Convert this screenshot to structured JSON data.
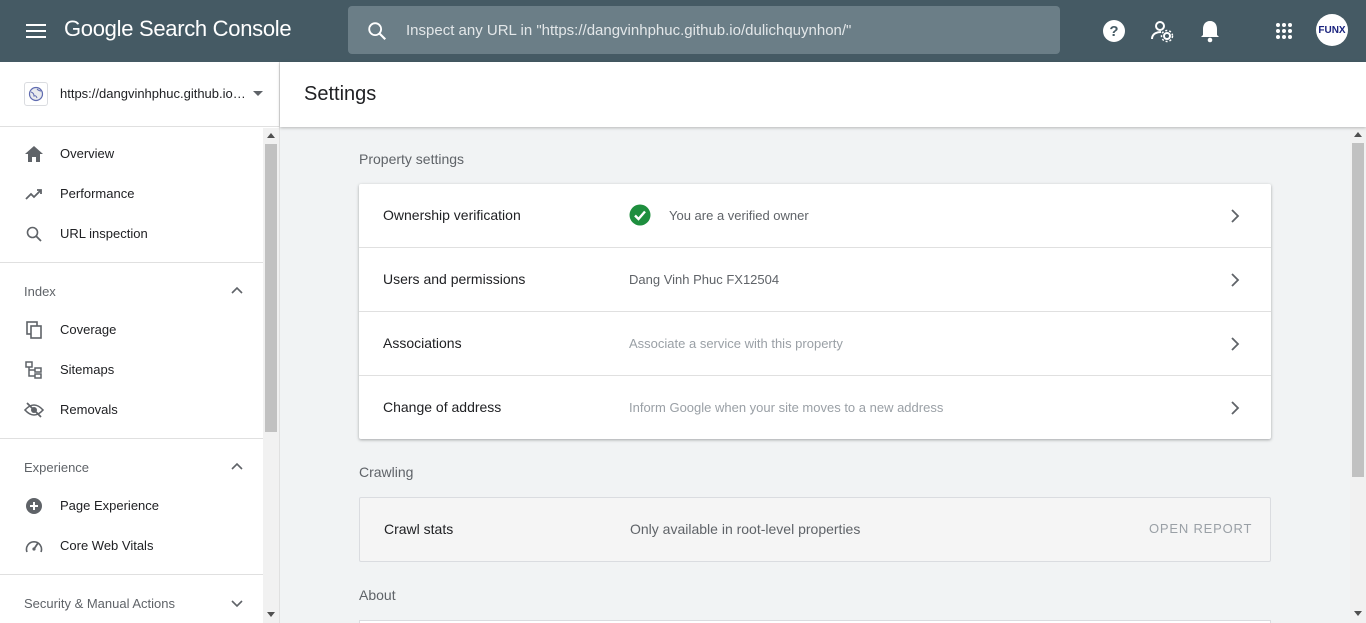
{
  "topbar": {
    "app_title": "Google Search Console",
    "search_placeholder": "Inspect any URL in \"https://dangvinhphuc.github.io/dulichquynhon/\"",
    "avatar_text": "FUNX",
    "icons": [
      "menu-icon",
      "search-icon",
      "help-icon",
      "manage-users-icon",
      "notifications-icon",
      "apps-grid-icon"
    ],
    "bar_color": "#455a64"
  },
  "property": {
    "url": "https://dangvinhphuc.github.io/dulichquynhon/"
  },
  "sidebar": {
    "top_items": [
      {
        "label": "Overview",
        "icon": "home-icon"
      },
      {
        "label": "Performance",
        "icon": "trending-up-icon"
      },
      {
        "label": "URL inspection",
        "icon": "search-icon"
      }
    ],
    "index": {
      "title": "Index",
      "items": [
        {
          "label": "Coverage",
          "icon": "coverage-icon"
        },
        {
          "label": "Sitemaps",
          "icon": "sitemap-icon"
        },
        {
          "label": "Removals",
          "icon": "visibility-off-icon"
        }
      ]
    },
    "experience": {
      "title": "Experience",
      "items": [
        {
          "label": "Page Experience",
          "icon": "page-experience-icon"
        },
        {
          "label": "Core Web Vitals",
          "icon": "speed-gauge-icon"
        }
      ]
    },
    "security": {
      "title": "Security & Manual Actions"
    }
  },
  "page": {
    "title": "Settings"
  },
  "property_settings": {
    "title": "Property settings",
    "rows": [
      {
        "label": "Ownership verification",
        "value": "You are a verified owner",
        "status": "verified"
      },
      {
        "label": "Users and permissions",
        "value": "Dang Vinh Phuc FX12504"
      },
      {
        "label": "Associations",
        "value": "Associate a service with this property"
      },
      {
        "label": "Change of address",
        "value": "Inform Google when your site moves to a new address"
      }
    ]
  },
  "crawling": {
    "title": "Crawling",
    "label": "Crawl stats",
    "value": "Only available in root-level properties",
    "button": "OPEN REPORT"
  },
  "about": {
    "title": "About"
  },
  "colors": {
    "verified_green": "#1e8e3e",
    "accent": "#1a73e8"
  }
}
